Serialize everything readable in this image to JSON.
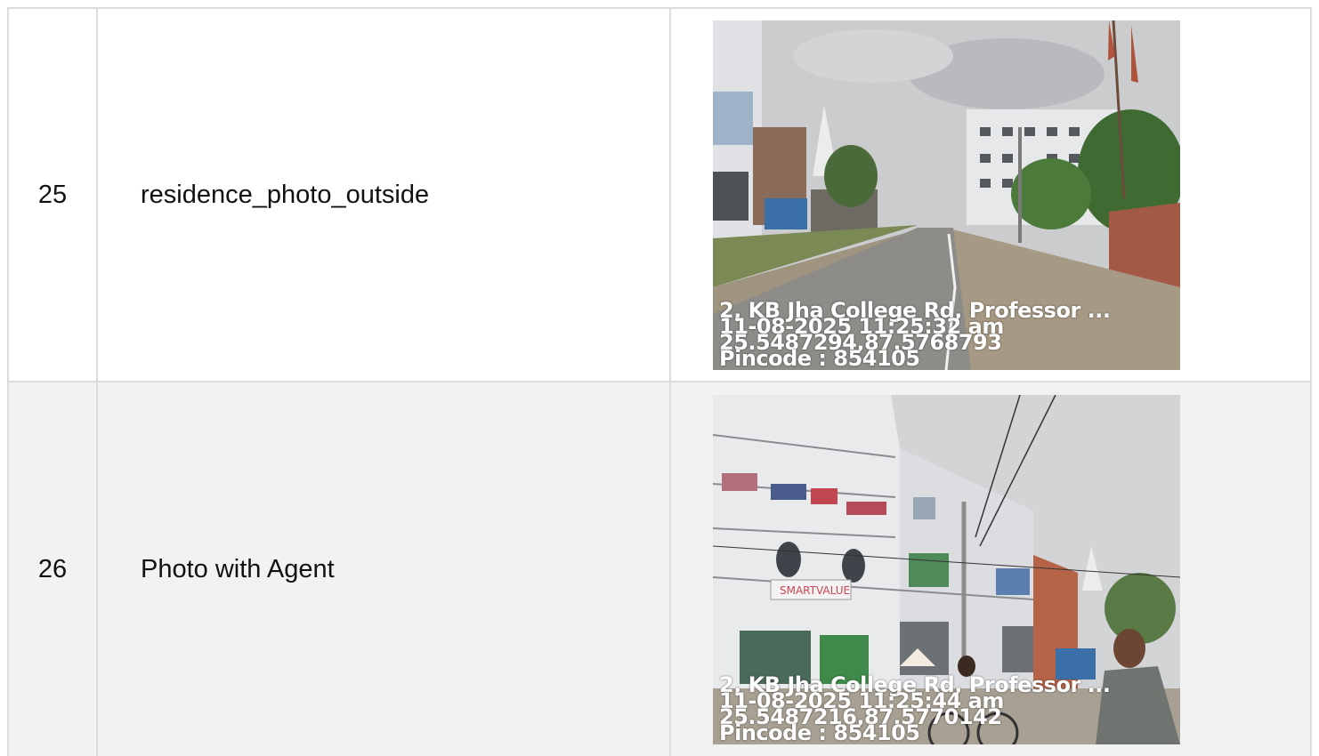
{
  "rows": [
    {
      "number": "25",
      "label": "residence_photo_outside",
      "photo": {
        "subject": "street-view-road-buildings",
        "stamp": {
          "address": "2, KB Jha College Rd, Professor ...",
          "datetime": "11-08-2025 11:25:32 am",
          "coords": "25.5487294,87.5768793",
          "pincode": "Pincode : 854105"
        }
      }
    },
    {
      "number": "26",
      "label": "Photo with Agent",
      "photo": {
        "subject": "multi-storey-building-with-agent",
        "stamp": {
          "address": "2, KB Jha College Rd, Professor ...",
          "datetime": "11-08-2025 11:25:44 am",
          "coords": "25.5487216,87.5770142",
          "pincode": "Pincode : 854105"
        },
        "sign_text": "SMARTVALUE"
      }
    }
  ],
  "colors": {
    "border": "#dcdcdc",
    "row_alt_bg": "#f2f2f2",
    "sky": "#c9cacc",
    "road": "#8d8c89"
  }
}
